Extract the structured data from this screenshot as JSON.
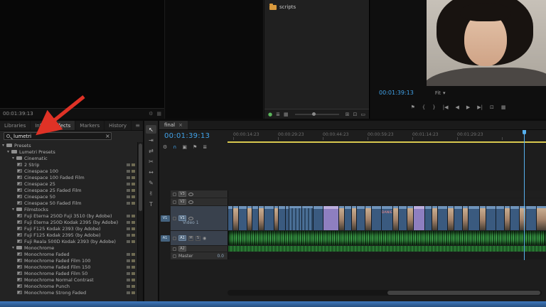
{
  "icons": {
    "chevron_down": "▾",
    "panel_menu": "≡",
    "mic": "◉"
  },
  "source_monitor": {
    "timecode": "00:01:39:13",
    "icons": [
      {
        "name": "settings-icon",
        "glyph": "⚙"
      },
      {
        "name": "grid-icon",
        "glyph": "▦"
      }
    ]
  },
  "project_panel": {
    "rows": [
      {
        "icon": "bin-folder-icon",
        "label": "scripts"
      }
    ],
    "left_icons": [
      {
        "name": "project-writable-icon",
        "glyph": "●",
        "color": "#5cb85c"
      },
      {
        "name": "list-view-icon",
        "glyph": "≣"
      },
      {
        "name": "icon-view-icon",
        "glyph": "▦"
      }
    ],
    "right_icons": [
      {
        "name": "new-bin-icon",
        "glyph": "⊞"
      },
      {
        "name": "new-item-icon",
        "glyph": "⊡"
      },
      {
        "name": "delete-icon",
        "glyph": "▭"
      }
    ]
  },
  "program_monitor": {
    "timecode": "00:01:39:13",
    "zoom_level": "Fit",
    "transport_icons": [
      {
        "name": "add-marker-icon",
        "glyph": "⚑"
      },
      {
        "name": "mark-in-icon",
        "glyph": "{"
      },
      {
        "name": "mark-out-icon",
        "glyph": "}"
      },
      {
        "name": "go-to-in-icon",
        "glyph": "|◀"
      },
      {
        "name": "step-back-icon",
        "glyph": "◀"
      },
      {
        "name": "play-icon",
        "glyph": "▶"
      },
      {
        "name": "step-forward-icon",
        "glyph": "▶|"
      },
      {
        "name": "lift-icon",
        "glyph": "⊡"
      },
      {
        "name": "export-frame-icon",
        "glyph": "▦"
      }
    ]
  },
  "effects_panel": {
    "tabs": [
      {
        "label": "Libraries",
        "active": false
      },
      {
        "label": "Info",
        "active": false
      },
      {
        "label": "Effects",
        "active": true
      },
      {
        "label": "Markers",
        "active": false
      },
      {
        "label": "History",
        "active": false
      }
    ],
    "search": {
      "value": "lumetri",
      "clear": "×"
    },
    "tree": [
      {
        "indent": 0,
        "kind": "bin",
        "label": "Presets"
      },
      {
        "indent": 1,
        "kind": "bin",
        "label": "Lumetri Presets"
      },
      {
        "indent": 2,
        "kind": "bin",
        "label": "Cinematic"
      },
      {
        "indent": 3,
        "kind": "preset",
        "label": "2 Strip"
      },
      {
        "indent": 3,
        "kind": "preset",
        "label": "Cinespace 100"
      },
      {
        "indent": 3,
        "kind": "preset",
        "label": "Cinespace 100 Faded Film"
      },
      {
        "indent": 3,
        "kind": "preset",
        "label": "Cinespace 25"
      },
      {
        "indent": 3,
        "kind": "preset",
        "label": "Cinespace 25 Faded Film"
      },
      {
        "indent": 3,
        "kind": "preset",
        "label": "Cinespace 50"
      },
      {
        "indent": 3,
        "kind": "preset",
        "label": "Cinespace 50 Faded Film"
      },
      {
        "indent": 2,
        "kind": "bin",
        "label": "Filmstocks"
      },
      {
        "indent": 3,
        "kind": "preset",
        "label": "Fuji Eterna 250D Fuji 3510 (by Adobe)"
      },
      {
        "indent": 3,
        "kind": "preset",
        "label": "Fuji Eterna 250D Kodak 2395 (by Adobe)"
      },
      {
        "indent": 3,
        "kind": "preset",
        "label": "Fuji F125 Kodak 2393 (by Adobe)"
      },
      {
        "indent": 3,
        "kind": "preset",
        "label": "Fuji F125 Kodak 2395 (by Adobe)"
      },
      {
        "indent": 3,
        "kind": "preset",
        "label": "Fuji Reala 500D Kodak 2393 (by Adobe)"
      },
      {
        "indent": 2,
        "kind": "bin",
        "label": "Monochrome"
      },
      {
        "indent": 3,
        "kind": "preset",
        "label": "Monochrome Faded"
      },
      {
        "indent": 3,
        "kind": "preset",
        "label": "Monochrome Faded Film 100"
      },
      {
        "indent": 3,
        "kind": "preset",
        "label": "Monochrome Faded Film 150"
      },
      {
        "indent": 3,
        "kind": "preset",
        "label": "Monochrome Faded Film 50"
      },
      {
        "indent": 3,
        "kind": "preset",
        "label": "Monochrome Normal Contrast"
      },
      {
        "indent": 3,
        "kind": "preset",
        "label": "Monochrome Punch"
      },
      {
        "indent": 3,
        "kind": "preset",
        "label": "Monochrome Strong Faded"
      }
    ]
  },
  "tools": [
    {
      "name": "selection-tool",
      "glyph": "↖",
      "active": true
    },
    {
      "name": "track-select-tool",
      "glyph": "⇥",
      "active": false
    },
    {
      "name": "ripple-edit-tool",
      "glyph": "⇄",
      "active": false
    },
    {
      "name": "razor-tool",
      "glyph": "✂",
      "active": false
    },
    {
      "name": "slip-tool",
      "glyph": "↔",
      "active": false
    },
    {
      "name": "pen-tool",
      "glyph": "✎",
      "active": false
    },
    {
      "name": "hand-tool",
      "glyph": "✌",
      "active": false
    },
    {
      "name": "type-tool",
      "glyph": "T",
      "active": false
    }
  ],
  "timeline": {
    "tab_label": "final",
    "tab_close": "×",
    "timecode": "00:01:39:13",
    "ruler_labels": [
      "00:00:14:23",
      "00:00:29:23",
      "00:00:44:23",
      "00:00:59:23",
      "00:01:14:23",
      "00:01:29:23"
    ],
    "toolbar_icons": [
      {
        "name": "timeline-settings-icon",
        "glyph": "⚙",
        "active": false
      },
      {
        "name": "snap-icon",
        "glyph": "∩",
        "active": true
      },
      {
        "name": "linked-selection-icon",
        "glyph": "▣",
        "active": false
      },
      {
        "name": "add-marker-icon",
        "glyph": "⚑",
        "active": false
      },
      {
        "name": "timeline-menu-icon",
        "glyph": "≣",
        "active": false
      }
    ],
    "video_tracks": [
      {
        "id": "V3",
        "name": ""
      },
      {
        "id": "V2",
        "name": ""
      },
      {
        "id": "V1",
        "name": "Video 1"
      }
    ],
    "audio_tracks": [
      {
        "id": "A1"
      },
      {
        "id": "A2"
      }
    ],
    "track_buttons": {
      "mute": "M",
      "solo": "S"
    },
    "master": {
      "label": "Master",
      "level": "0.0"
    },
    "clip_label_text": "DANIELLE",
    "clips": [
      {
        "w": 7,
        "k": "blue"
      },
      {
        "w": 8,
        "k": "thumb"
      },
      {
        "w": 12,
        "k": "blue"
      },
      {
        "w": 7,
        "k": "thumb"
      },
      {
        "w": 9,
        "k": "blue"
      },
      {
        "w": 8,
        "k": "thumb"
      },
      {
        "w": 14,
        "k": "blue"
      },
      {
        "w": 6,
        "k": "thumb"
      },
      {
        "w": 10,
        "k": "blue"
      },
      {
        "w": 5,
        "k": "blue"
      },
      {
        "w": 18,
        "k": "stripes"
      },
      {
        "w": 16,
        "k": "stripes"
      },
      {
        "w": 14,
        "k": "blue"
      },
      {
        "w": 22,
        "k": "purple"
      },
      {
        "w": 8,
        "k": "thumb"
      },
      {
        "w": 10,
        "k": "blue"
      },
      {
        "w": 7,
        "k": "thumb"
      },
      {
        "w": 12,
        "k": "blue"
      },
      {
        "w": 9,
        "k": "thumb"
      },
      {
        "w": 14,
        "k": "blue"
      },
      {
        "w": 16,
        "k": "label"
      },
      {
        "w": 8,
        "k": "thumb"
      },
      {
        "w": 12,
        "k": "blue"
      },
      {
        "w": 9,
        "k": "thumb"
      },
      {
        "w": 16,
        "k": "purple"
      },
      {
        "w": 10,
        "k": "blue"
      },
      {
        "w": 8,
        "k": "thumb"
      },
      {
        "w": 14,
        "k": "blue"
      },
      {
        "w": 9,
        "k": "thumb"
      },
      {
        "w": 12,
        "k": "blue"
      },
      {
        "w": 8,
        "k": "thumb"
      },
      {
        "w": 16,
        "k": "blue"
      },
      {
        "w": 9,
        "k": "thumb"
      },
      {
        "w": 14,
        "k": "blue"
      },
      {
        "w": 12,
        "k": "blue"
      },
      {
        "w": 8,
        "k": "thumb"
      },
      {
        "w": 13,
        "k": "blue"
      },
      {
        "w": 9,
        "k": "thumb"
      },
      {
        "w": 15,
        "k": "blue"
      },
      {
        "w": 14,
        "k": "thumb"
      }
    ],
    "colors": {
      "accent_blue": "#41a2e8",
      "clip_blue": "#3a5a7f",
      "clip_purple": "#8e7fc0",
      "audio_green": "#2f8f3d",
      "work_area_yellow": "#d8c84e"
    }
  },
  "annotation": {
    "name": "red-arrow",
    "color": "#df3226"
  },
  "window": {
    "bottom_bar_blue": "#2f5f9e"
  }
}
